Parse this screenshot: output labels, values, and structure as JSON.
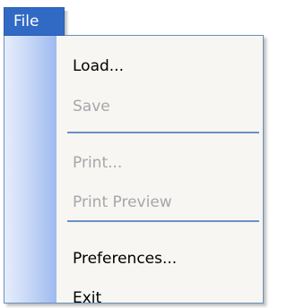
{
  "menu": {
    "header_label": "File",
    "items": [
      {
        "label": "Load...",
        "enabled": true
      },
      {
        "label": "Save",
        "enabled": false
      },
      {
        "label": "Print...",
        "enabled": false
      },
      {
        "label": "Print Preview",
        "enabled": false
      },
      {
        "label": "Preferences...",
        "enabled": true
      },
      {
        "label": "Exit",
        "enabled": true
      }
    ]
  },
  "colors": {
    "header_bg": "#316ac5",
    "header_text": "#ffffff",
    "menu_bg": "#f7f6f3",
    "gutter_dark": "#9dbaf0",
    "separator": "#6a90c8",
    "disabled_text": "#a7a6aa"
  }
}
